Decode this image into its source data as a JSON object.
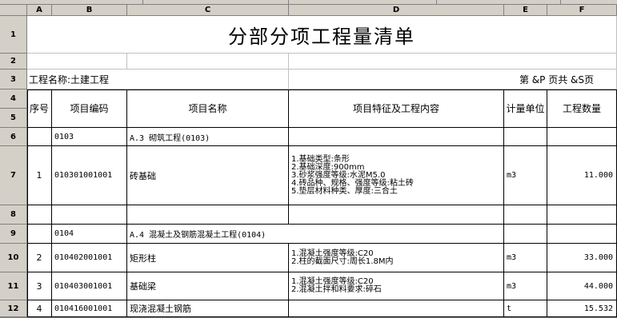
{
  "columns": [
    "A",
    "B",
    "C",
    "D",
    "E",
    "F"
  ],
  "rows": [
    "1",
    "2",
    "3",
    "4",
    "5",
    "6",
    "7",
    "8",
    "9",
    "10",
    "11",
    "12"
  ],
  "sheet": {
    "title": "分部分项工程量清单",
    "project_name": "工程名称:土建工程",
    "page_info": "第 &P 页共 &S页"
  },
  "header": {
    "seq": "序号",
    "code": "项目编码",
    "name": "项目名称",
    "features": "项目特征及工程内容",
    "unit": "计量单位",
    "qty": "工程数量"
  },
  "items": [
    {
      "seq": "",
      "code": "0103",
      "name": "",
      "section": "A.3 砌筑工程(0103)",
      "features": [],
      "unit": "",
      "qty": ""
    },
    {
      "seq": "1",
      "code": "010301001001",
      "name": "砖基础",
      "features": [
        "1.基础类型:条形",
        "2.基础深度:900mm",
        "3.砂浆强度等级:水泥M5.0",
        "4.砖品种、规格、强度等级:粘土砖",
        "5.垫层材料种类、厚度:三合土"
      ],
      "unit": "m3",
      "qty": "11.000"
    },
    {
      "seq": "",
      "code": "",
      "name": "",
      "features": [],
      "unit": "",
      "qty": ""
    },
    {
      "seq": "",
      "code": "0104",
      "name": "",
      "section": "A.4 混凝土及钢筋混凝土工程(0104)",
      "features": [],
      "unit": "",
      "qty": ""
    },
    {
      "seq": "2",
      "code": "010402001001",
      "name": "矩形柱",
      "features": [
        "1.混凝土强度等级:C20",
        "2.柱的截面尺寸:周长1.8M内"
      ],
      "unit": "m3",
      "qty": "33.000"
    },
    {
      "seq": "3",
      "code": "010403001001",
      "name": "基础梁",
      "features": [
        "1.混凝土强度等级:C20",
        "2.混凝土拌和料要求:碎石"
      ],
      "unit": "m3",
      "qty": "44.000"
    },
    {
      "seq": "4",
      "code": "010416001001",
      "name": "现浇混凝土钢筋",
      "features": [],
      "unit": "t",
      "qty": "15.532"
    }
  ]
}
